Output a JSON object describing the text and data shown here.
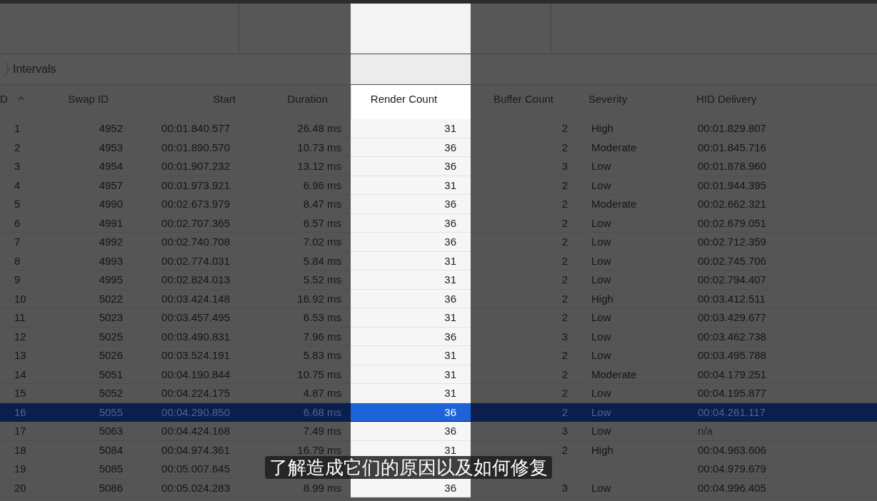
{
  "breadcrumb": {
    "label": "Intervals"
  },
  "table": {
    "columns": [
      {
        "label": "D",
        "sorted": true,
        "spotlight": false
      },
      {
        "label": "Swap ID",
        "sorted": false,
        "spotlight": false
      },
      {
        "label": "Start",
        "sorted": false,
        "spotlight": false
      },
      {
        "label": "Duration",
        "sorted": false,
        "spotlight": false
      },
      {
        "label": "Render Count",
        "sorted": false,
        "spotlight": true
      },
      {
        "label": "Buffer Count",
        "sorted": false,
        "spotlight": false
      },
      {
        "label": "Severity",
        "sorted": false,
        "spotlight": false
      },
      {
        "label": "HID Delivery",
        "sorted": false,
        "spotlight": false
      }
    ],
    "rows": [
      {
        "selected": false,
        "cells": [
          "1",
          "4952",
          "00:01.840.577",
          "26.48 ms",
          "31",
          "2",
          "High",
          "00:01.829.807"
        ]
      },
      {
        "selected": false,
        "cells": [
          "2",
          "4953",
          "00:01.890.570",
          "10.73 ms",
          "36",
          "2",
          "Moderate",
          "00:01.845.716"
        ]
      },
      {
        "selected": false,
        "cells": [
          "3",
          "4954",
          "00:01.907.232",
          "13.12 ms",
          "36",
          "3",
          "Low",
          "00:01.878.960"
        ]
      },
      {
        "selected": false,
        "cells": [
          "4",
          "4957",
          "00:01.973.921",
          "6.96 ms",
          "31",
          "2",
          "Low",
          "00:01.944.395"
        ]
      },
      {
        "selected": false,
        "cells": [
          "5",
          "4990",
          "00:02.673.979",
          "8.47 ms",
          "36",
          "2",
          "Moderate",
          "00:02.662.321"
        ]
      },
      {
        "selected": false,
        "cells": [
          "6",
          "4991",
          "00:02.707.365",
          "6.57 ms",
          "36",
          "2",
          "Low",
          "00:02.679.051"
        ]
      },
      {
        "selected": false,
        "cells": [
          "7",
          "4992",
          "00:02.740.708",
          "7.02 ms",
          "36",
          "2",
          "Low",
          "00:02.712.359"
        ]
      },
      {
        "selected": false,
        "cells": [
          "8",
          "4993",
          "00:02.774.031",
          "5.84 ms",
          "31",
          "2",
          "Low",
          "00:02.745.706"
        ]
      },
      {
        "selected": false,
        "cells": [
          "9",
          "4995",
          "00:02.824.013",
          "5.52 ms",
          "31",
          "2",
          "Low",
          "00:02.794.407"
        ]
      },
      {
        "selected": false,
        "cells": [
          "10",
          "5022",
          "00:03.424.148",
          "16.92 ms",
          "36",
          "2",
          "High",
          "00:03.412.511"
        ]
      },
      {
        "selected": false,
        "cells": [
          "11",
          "5023",
          "00:03.457.495",
          "6.53 ms",
          "31",
          "2",
          "Low",
          "00:03.429.677"
        ]
      },
      {
        "selected": false,
        "cells": [
          "12",
          "5025",
          "00:03.490.831",
          "7.96 ms",
          "36",
          "3",
          "Low",
          "00:03.462.738"
        ]
      },
      {
        "selected": false,
        "cells": [
          "13",
          "5026",
          "00:03.524.191",
          "5.83 ms",
          "31",
          "2",
          "Low",
          "00:03.495.788"
        ]
      },
      {
        "selected": false,
        "cells": [
          "14",
          "5051",
          "00:04.190.844",
          "10.75 ms",
          "31",
          "2",
          "Moderate",
          "00:04.179.251"
        ]
      },
      {
        "selected": false,
        "cells": [
          "15",
          "5052",
          "00:04.224.175",
          "4.87 ms",
          "31",
          "2",
          "Low",
          "00:04.195.877"
        ]
      },
      {
        "selected": true,
        "cells": [
          "16",
          "5055",
          "00:04.290.850",
          "6.68 ms",
          "36",
          "2",
          "Low",
          "00:04.261.117"
        ]
      },
      {
        "selected": false,
        "cells": [
          "17",
          "5063",
          "00:04.424.168",
          "7.49 ms",
          "36",
          "3",
          "Low",
          "n/a"
        ]
      },
      {
        "selected": false,
        "cells": [
          "18",
          "5084",
          "00:04.974.361",
          "16.79 ms",
          "31",
          "2",
          "High",
          "00:04.963.606"
        ]
      },
      {
        "selected": false,
        "cells": [
          "19",
          "5085",
          "00:05.007.645",
          null,
          null,
          null,
          null,
          "00:04.979.679"
        ]
      },
      {
        "selected": false,
        "cells": [
          "20",
          "5086",
          "00:05.024.283",
          "8.99 ms",
          "36",
          "3",
          "Low",
          "00:04.996.405"
        ]
      }
    ]
  },
  "subtitle": "了解造成它们的原因以及如何修复"
}
